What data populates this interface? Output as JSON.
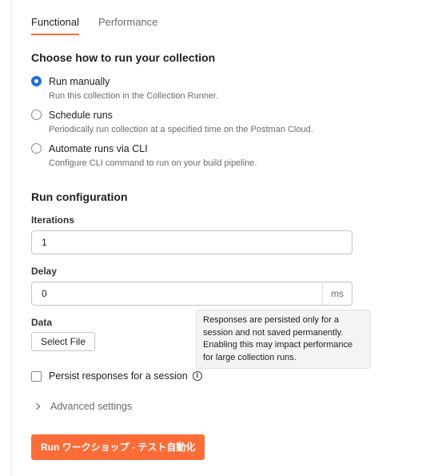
{
  "tabs": [
    {
      "label": "Functional",
      "active": true
    },
    {
      "label": "Performance",
      "active": false
    }
  ],
  "run_mode": {
    "title": "Choose how to run your collection",
    "options": [
      {
        "label": "Run manually",
        "description": "Run this collection in the Collection Runner.",
        "selected": true
      },
      {
        "label": "Schedule runs",
        "description": "Periodically run collection at a specified time on the Postman Cloud.",
        "selected": false
      },
      {
        "label": "Automate runs via CLI",
        "description": "Configure CLI command to run on your build pipeline.",
        "selected": false
      }
    ]
  },
  "run_config": {
    "title": "Run configuration",
    "iterations": {
      "label": "Iterations",
      "value": "1"
    },
    "delay": {
      "label": "Delay",
      "value": "0",
      "unit": "ms"
    },
    "data": {
      "label": "Data",
      "button": "Select File"
    },
    "persist": {
      "label": "Persist responses for a session",
      "checked": false
    },
    "tooltip": "Responses are persisted only for a session and not saved permanently. Enabling this may impact performance for large collection runs.",
    "advanced_label": "Advanced settings"
  },
  "run_button": "Run ワークショップ - テスト自動化",
  "colors": {
    "accent": "#ff6c37",
    "radio_selected": "#1d6fdc"
  },
  "icons": {
    "info": "info-icon",
    "chevron": "chevron-right-icon"
  }
}
